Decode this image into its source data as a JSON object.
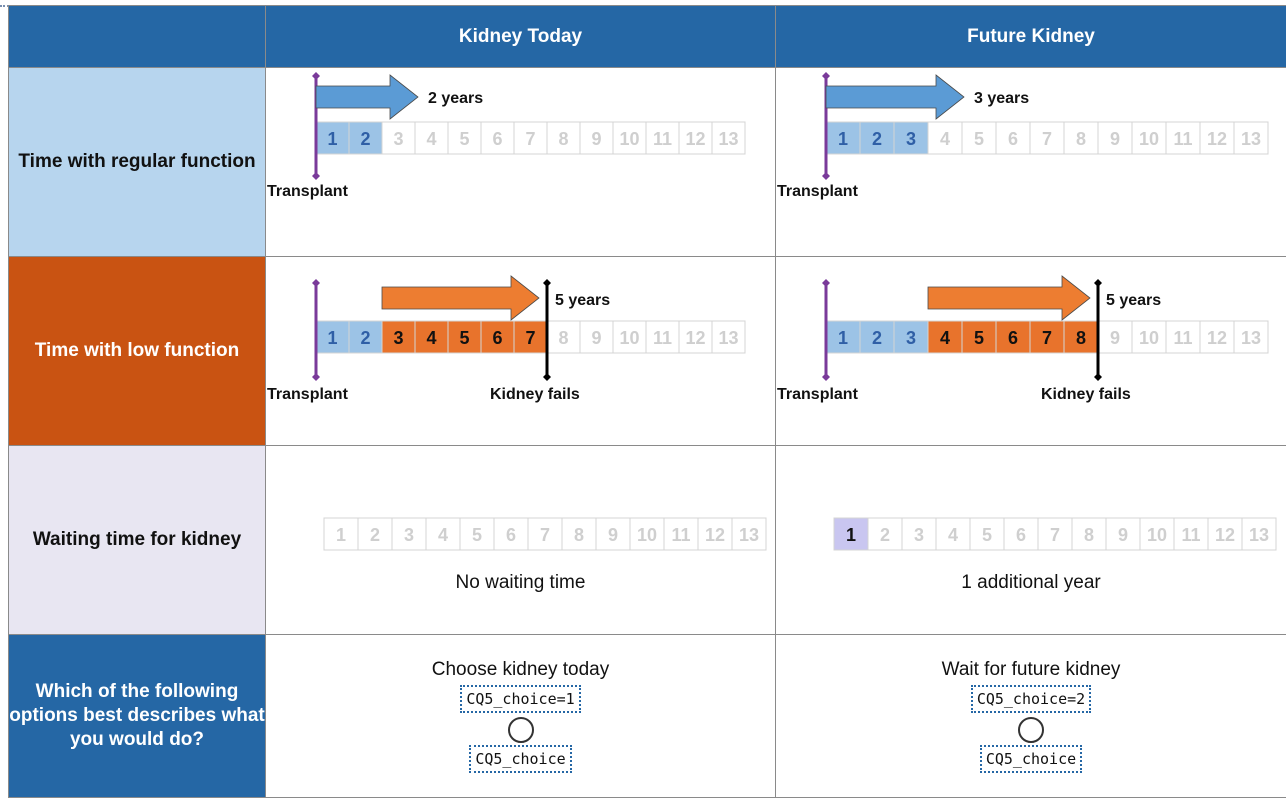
{
  "columns": {
    "today": "Kidney Today",
    "future": "Future Kidney"
  },
  "rows": {
    "regular": "Time with regular function",
    "low": "Time with low function",
    "waiting": "Waiting time for kidney",
    "question": "Which of the following options best describes what you would do?"
  },
  "timeline_numbers": [
    "1",
    "2",
    "3",
    "4",
    "5",
    "6",
    "7",
    "8",
    "9",
    "10",
    "11",
    "12",
    "13"
  ],
  "today": {
    "regular_label": "2 years",
    "regular_years": 2,
    "low_label": "5 years",
    "low_years": 5,
    "transplant_label": "Transplant",
    "fail_label": "Kidney fails",
    "waiting_years": 0,
    "waiting_text": "No waiting time",
    "choice_text": "Choose kidney today",
    "choice_tag": "CQ5_choice=1",
    "field_tag": "CQ5_choice"
  },
  "future": {
    "regular_label": "3 years",
    "regular_years": 3,
    "low_label": "5 years",
    "low_years": 5,
    "transplant_label": "Transplant",
    "fail_label": "Kidney fails",
    "waiting_years": 1,
    "waiting_text": "1 additional year",
    "choice_text": "Wait for future kidney",
    "choice_tag": "CQ5_choice=2",
    "field_tag": "CQ5_choice"
  },
  "colors": {
    "header_blue": "#2567a5",
    "regular_fill": "#9cc3e6",
    "low_fill": "#e8732c",
    "wait_fill": "#c9c6f0",
    "transplant_line": "#7a3a9a",
    "arrow_blue": "#5b9bd5",
    "arrow_orange": "#ed7d31"
  }
}
